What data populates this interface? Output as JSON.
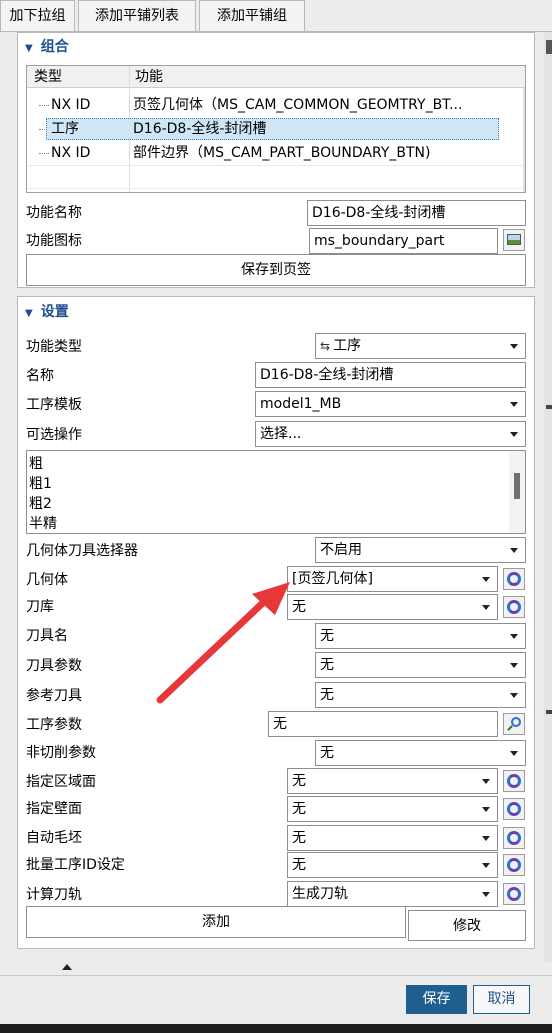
{
  "tabs": [
    {
      "label": "加下拉组"
    },
    {
      "label": "添加平铺列表"
    },
    {
      "label": "添加平铺组"
    }
  ],
  "group_section": {
    "title": "组合",
    "grid": {
      "headers": [
        "类型",
        "功能"
      ],
      "rows": [
        {
          "type": "NX ID",
          "function": "页签几何体（MS_CAM_COMMON_GEOMTRY_BT..."
        },
        {
          "type": "工序",
          "function": "D16-D8-全线-封闭槽"
        },
        {
          "type": "NX ID",
          "function": "部件边界（MS_CAM_PART_BOUNDARY_BTN)"
        }
      ]
    },
    "func_name_label": "功能名称",
    "func_name_value": "D16-D8-全线-封闭槽",
    "func_icon_label": "功能图标",
    "func_icon_value": "ms_boundary_part",
    "save_tab_button": "保存到页签"
  },
  "settings_section": {
    "title": "设置",
    "func_type_label": "功能类型",
    "func_type_value": "工序",
    "name_label": "名称",
    "name_value": "D16-D8-全线-封闭槽",
    "template_label": "工序模板",
    "template_value": "model1_MB",
    "optional_label": "可选操作",
    "optional_value": "选择...",
    "list_items": [
      "粗",
      "粗1",
      "粗2",
      "半精"
    ],
    "geo_selector_label": "几何体刀具选择器",
    "geo_selector_value": "不启用",
    "geometry_label": "几何体",
    "geometry_value": "[页签几何体]",
    "tool_lib_label": "刀库",
    "tool_lib_value": "无",
    "tool_name_label": "刀具名",
    "tool_name_value": "无",
    "tool_param_label": "刀具参数",
    "tool_param_value": "无",
    "ref_tool_label": "参考刀具",
    "ref_tool_value": "无",
    "op_param_label": "工序参数",
    "op_param_value": "无",
    "noncut_label": "非切削参数",
    "noncut_value": "无",
    "area_label": "指定区域面",
    "area_value": "无",
    "wall_label": "指定壁面",
    "wall_value": "无",
    "blank_label": "自动毛坯",
    "blank_value": "无",
    "batch_label": "批量工序ID设定",
    "batch_value": "无",
    "path_label": "计算刀轨",
    "path_value": "生成刀轨",
    "add_button": "添加",
    "modify_button": "修改"
  },
  "footer": {
    "save_button": "保存",
    "cancel_button": "取消"
  },
  "colors": {
    "accent": "#1f5f8f",
    "annotation_arrow": "#e8373a",
    "selected_row": "#cfe6f5"
  }
}
